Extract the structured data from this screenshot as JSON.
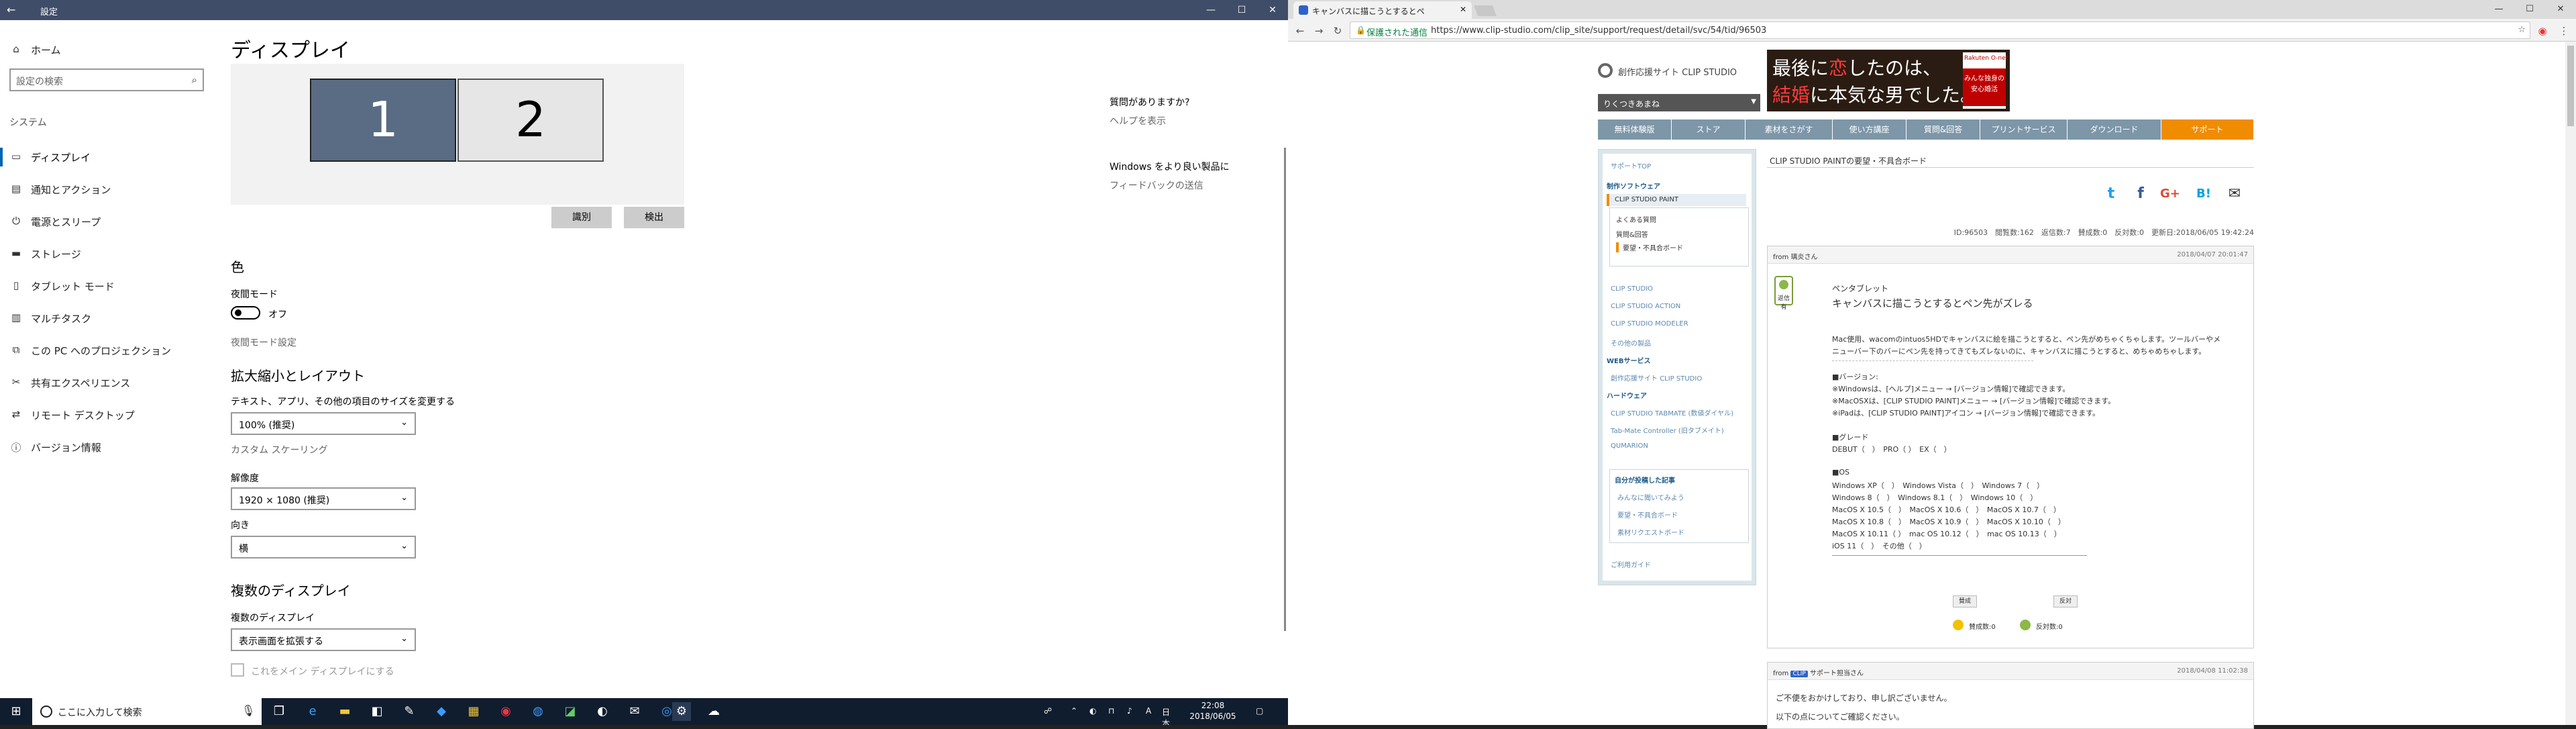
{
  "settings": {
    "window_title": "設定",
    "sidebar": {
      "home": "ホーム",
      "search_placeholder": "設定の検索",
      "section": "システム",
      "items": [
        {
          "label": "ディスプレイ",
          "icon": "monitor-icon"
        },
        {
          "label": "通知とアクション",
          "icon": "notification-icon"
        },
        {
          "label": "電源とスリープ",
          "icon": "power-icon"
        },
        {
          "label": "ストレージ",
          "icon": "storage-icon"
        },
        {
          "label": "タブレット モード",
          "icon": "tablet-icon"
        },
        {
          "label": "マルチタスク",
          "icon": "multitask-icon"
        },
        {
          "label": "この PC へのプロジェクション",
          "icon": "projection-icon"
        },
        {
          "label": "共有エクスペリエンス",
          "icon": "share-icon"
        },
        {
          "label": "リモート デスクトップ",
          "icon": "remote-icon"
        },
        {
          "label": "バージョン情報",
          "icon": "info-icon"
        }
      ]
    },
    "main": {
      "title": "ディスプレイ",
      "monitors": [
        "1",
        "2"
      ],
      "identify_button": "識別",
      "detect_button": "検出",
      "color_heading": "色",
      "night_light_label": "夜間モード",
      "night_light_state": "オフ",
      "night_light_settings": "夜間モード設定",
      "scale_heading": "拡大縮小とレイアウト",
      "scale_label": "テキスト、アプリ、その他の項目のサイズを変更する",
      "scale_value": "100% (推奨)",
      "custom_scaling": "カスタム スケーリング",
      "resolution_label": "解像度",
      "resolution_value": "1920 × 1080 (推奨)",
      "orientation_label": "向き",
      "orientation_value": "横",
      "multi_heading": "複数のディスプレイ",
      "multi_label": "複数のディスプレイ",
      "multi_value": "表示画面を拡張する",
      "main_display_checkbox": "これをメイン ディスプレイにする"
    },
    "aside": {
      "question_heading": "質問がありますか?",
      "help_link": "ヘルプを表示",
      "feedback_heading": "Windows をより良い製品に",
      "feedback_link": "フィードバックの送信"
    }
  },
  "taskbar": {
    "search_placeholder": "ここに入力して検索",
    "time": "22:08",
    "date": "2018/06/05",
    "ime": "A",
    "lang": "日本"
  },
  "browser": {
    "tab_title": "キャンバスに描こうとするとペ",
    "secure_label": "保護された通信",
    "url": "https://www.clip-studio.com/clip_site/support/request/detail/svc/54/tid/96503"
  },
  "clip": {
    "logo_text": "創作応援サイト CLIP STUDIO",
    "ad": {
      "line1_a": "最後に",
      "line1_red": "恋",
      "line1_b": "したのは、",
      "line2_red": "結婚",
      "line2_b": "に本気な男でした。",
      "brand": "Rakuten O-net",
      "brand_tag": "みんな独身の安心婚活"
    },
    "user_name": "りくつきあまね",
    "nav": [
      "無料体験版",
      "ストア",
      "素材をさがす",
      "使い方講座",
      "質問&回答",
      "プリントサービス",
      "ダウンロード",
      "サポート"
    ],
    "leftnav": {
      "top": "サポートTOP",
      "software_heading": "制作ソフトウェア",
      "current_product": "CLIP STUDIO PAINT",
      "faq": "よくある質問",
      "qa": "質問&回答",
      "request_board": "要望・不具合ボード",
      "products": [
        "CLIP STUDIO",
        "CLIP STUDIO ACTION",
        "CLIP STUDIO MODELER",
        "その他の製品"
      ],
      "web_heading": "WEBサービス",
      "web_item": "創作応援サイト CLIP STUDIO",
      "hw_heading": "ハードウェア",
      "hw_items": [
        "CLIP STUDIO TABMATE (数値ダイヤル)",
        "Tab-Mate Controller (旧タブメイト)",
        "QUMARION"
      ],
      "my_heading": "自分が投稿した記事",
      "my_items": [
        "みんなに聞いてみよう",
        "要望・不具合ボード",
        "素材リクエストボード"
      ],
      "guide": "ご利用ガイド"
    },
    "breadcrumb": "CLIP STUDIO PAINTの要望・不具合ボード",
    "meta": "ID:96503　閲覧数:162　返信数:7　賛成数:0　反対数:0　更新日:2018/06/05 19:42:24",
    "post1": {
      "from_label": "from",
      "author": "璃炎",
      "author_suffix": "さん",
      "date": "2018/04/07 20:01:47",
      "badge": "返信有",
      "category": "ペンタブレット",
      "title": "キャンバスに描こうとするとペン先がズレる",
      "body1": "Mac使用、wacomのintuos5HDでキャンバスに絵を描こうとすると、ペン先がめちゃくちゃします。ツールバーやメ",
      "body2": "ニューバー下のバーにペン先を持ってきてもズレないのに、キャンバスに描こうとすると、めちゃめちゃします。",
      "version_heading": "■バージョン:",
      "version_lines": [
        "※Windowsは、[ヘルプ]メニュー → [バージョン情報]で確認できます。",
        "※MacOSXは、[CLIP STUDIO PAINT]メニュー → [バージョン情報]で確認できます。",
        "※iPadは、[CLIP STUDIO PAINT]アイコン → [バージョン情報]で確認できます。"
      ],
      "grade_heading": "■グレード",
      "grade_line": "DEBUT（　）　PRO（ ）　EX（　）",
      "os_heading": "■OS",
      "os_lines": [
        "Windows XP（　）　Windows Vista（　）　Windows 7（　）",
        "Windows 8（　）　Windows 8.1（　）　Windows 10（　）",
        "MacOS X 10.5（　）　MacOS X 10.6（　）　MacOS X 10.7（　）",
        "MacOS X 10.8（　）　MacOS X 10.9（　）　MacOS X 10.10（　）",
        "MacOS X 10.11（ ）　mac OS 10.12（　）　mac OS 10.13（　）",
        "iOS 11（　）　その他（　）"
      ],
      "agree_button": "賛成",
      "disagree_button": "反対",
      "agree_count_label": "賛成数:",
      "agree_count": "0",
      "disagree_count_label": "反対数:",
      "disagree_count": "0"
    },
    "post2": {
      "from_label": "from",
      "badge_text": "CLIP",
      "author": "サポート担当",
      "author_suffix": "さん",
      "date": "2018/04/08 11:02:38",
      "body1": "ご不便をおかけしており、申し訳ございません。",
      "body2": "以下の点についてご確認ください。"
    }
  }
}
